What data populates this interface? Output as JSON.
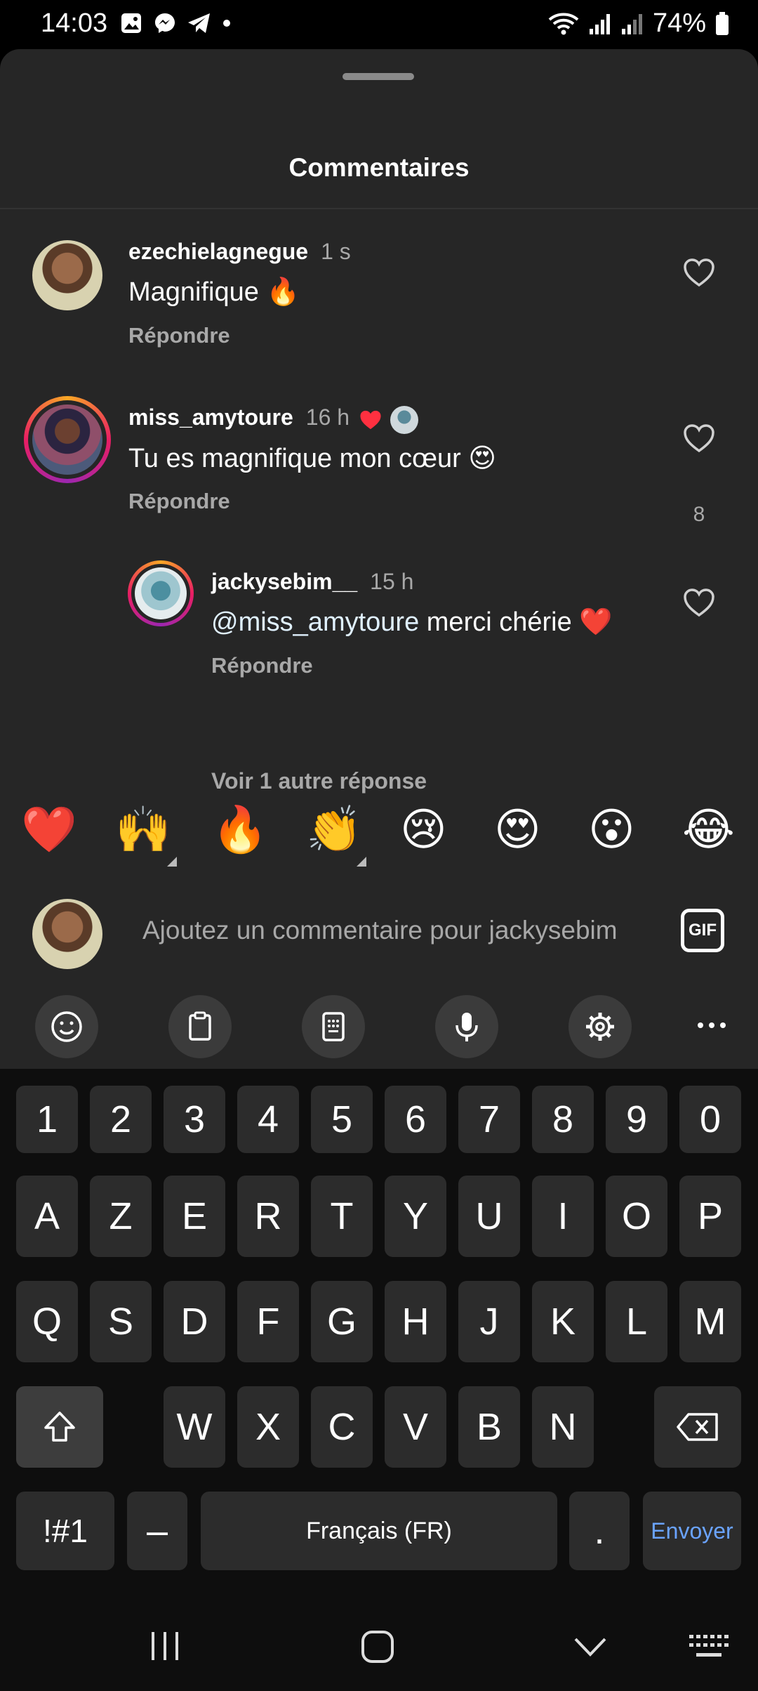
{
  "status_bar": {
    "time": "14:03",
    "battery": "74%"
  },
  "sheet": {
    "title": "Commentaires"
  },
  "comments": [
    {
      "username": "ezechielagnegue",
      "time": "1 s",
      "text": "Magnifique 🔥",
      "reply_label": "Répondre"
    },
    {
      "username": "miss_amytoure",
      "time": "16 h",
      "text": "Tu es magnifique mon cœur 😍",
      "reply_label": "Répondre",
      "likes": "8",
      "replies": [
        {
          "username": "jackysebim__",
          "time": "15 h",
          "mention": "@miss_amytoure",
          "text": " merci chérie ❤️",
          "reply_label": "Répondre"
        }
      ],
      "more_replies_label": "Voir 1 autre réponse"
    }
  ],
  "emoji_bar": [
    "❤️",
    "🙌",
    "🔥",
    "👏",
    "😢",
    "😍",
    "😮",
    "😂"
  ],
  "input": {
    "placeholder": "Ajoutez un commentaire pour jackysebim",
    "gif_label": "GIF"
  },
  "keyboard": {
    "row_numbers": [
      "1",
      "2",
      "3",
      "4",
      "5",
      "6",
      "7",
      "8",
      "9",
      "0"
    ],
    "row1": [
      "A",
      "Z",
      "E",
      "R",
      "T",
      "Y",
      "U",
      "I",
      "O",
      "P"
    ],
    "row2": [
      "Q",
      "S",
      "D",
      "F",
      "G",
      "H",
      "J",
      "K",
      "L",
      "M"
    ],
    "row3": [
      "W",
      "X",
      "C",
      "V",
      "B",
      "N"
    ],
    "symbols_label": "!#1",
    "dash_label": "–",
    "space_label": "Français (FR)",
    "period_label": ".",
    "send_label": "Envoyer"
  }
}
